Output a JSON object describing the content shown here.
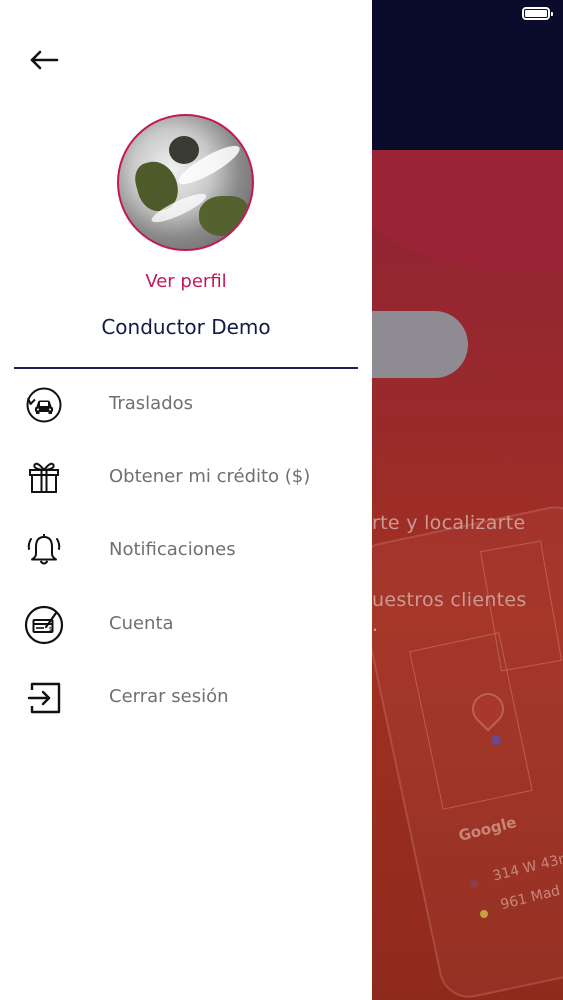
{
  "status_bar": {
    "battery_icon": "battery-full-icon"
  },
  "drawer": {
    "back_icon": "arrow-left-icon",
    "profile": {
      "link_label": "Ver perfil",
      "name": "Conductor Demo"
    },
    "menu": [
      {
        "label": "Traslados",
        "icon": "car-transfer-icon"
      },
      {
        "label": "Obtener mi crédito ($)",
        "icon": "gift-icon"
      },
      {
        "label": "Notificaciones",
        "icon": "bell-icon"
      },
      {
        "label": "Cuenta",
        "icon": "credit-card-icon"
      },
      {
        "label": "Cerrar sesión",
        "icon": "logout-icon"
      }
    ]
  },
  "background": {
    "text_line_1": "rte y localizarte",
    "text_line_2": "uestros clientes",
    "text_line_3": ".",
    "map_brand": "Google",
    "address_1": "314 W 43r",
    "address_2": "961 Mad"
  },
  "colors": {
    "accent": "#c2185b",
    "navy": "#15194a",
    "menu_text": "#6f6f76",
    "top_bar": "#0b0c2c",
    "overlay_red": "#a23022"
  }
}
